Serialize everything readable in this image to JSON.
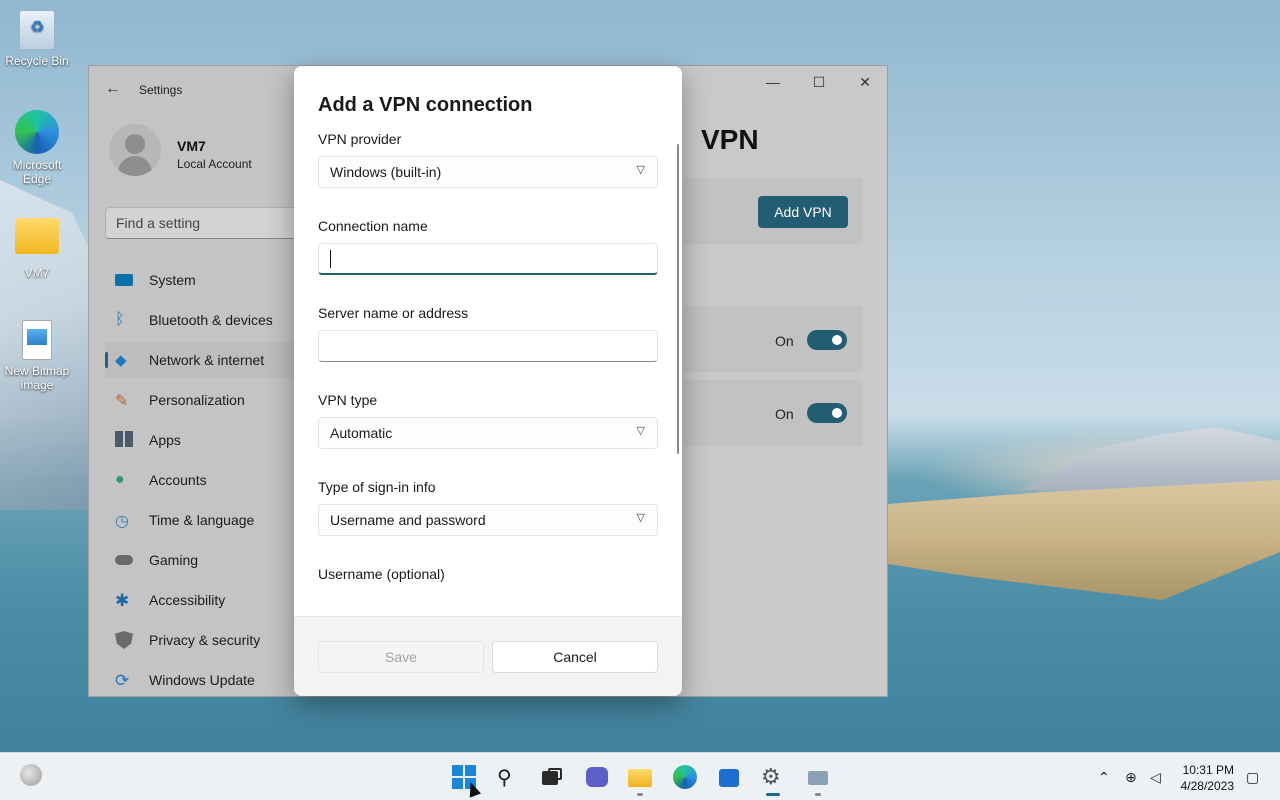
{
  "desktop": {
    "icons": [
      {
        "label": "Recycle Bin"
      },
      {
        "label": "Microsoft Edge"
      },
      {
        "label": "VM7"
      },
      {
        "label": "New Bitmap image"
      }
    ]
  },
  "settings": {
    "title": "Settings",
    "user": {
      "name": "VM7",
      "account_type": "Local Account"
    },
    "search_placeholder": "Find a setting",
    "nav": [
      {
        "label": "System",
        "icon": "system-icon",
        "color": "#0e6fb0"
      },
      {
        "label": "Bluetooth & devices",
        "icon": "bluetooth-icon",
        "color": "#1a78c2"
      },
      {
        "label": "Network & internet",
        "icon": "network-icon",
        "color": "#1a78c2",
        "active": true
      },
      {
        "label": "Personalization",
        "icon": "brush-icon",
        "color": "#b8622a"
      },
      {
        "label": "Apps",
        "icon": "apps-icon",
        "color": "#4a5a6a"
      },
      {
        "label": "Accounts",
        "icon": "accounts-icon",
        "color": "#2f9a6a"
      },
      {
        "label": "Time & language",
        "icon": "time-language-icon",
        "color": "#2f7fb5"
      },
      {
        "label": "Gaming",
        "icon": "gaming-icon",
        "color": "#6a6a6a"
      },
      {
        "label": "Accessibility",
        "icon": "accessibility-icon",
        "color": "#1b6aa8"
      },
      {
        "label": "Privacy & security",
        "icon": "shield-icon",
        "color": "#6b6b6b"
      },
      {
        "label": "Windows Update",
        "icon": "update-icon",
        "color": "#1a78c2"
      }
    ],
    "page_title": "VPN",
    "add_vpn_label": "Add VPN",
    "toggles": [
      {
        "label": "On",
        "state": true
      },
      {
        "label": "On",
        "state": true
      }
    ],
    "accent": "#235d73"
  },
  "dialog": {
    "title": "Add a VPN connection",
    "vpn_provider": {
      "label": "VPN provider",
      "value": "Windows (built-in)"
    },
    "connection_name": {
      "label": "Connection name",
      "value": ""
    },
    "server": {
      "label": "Server name or address",
      "value": ""
    },
    "vpn_type": {
      "label": "VPN type",
      "value": "Automatic"
    },
    "signin_type": {
      "label": "Type of sign-in info",
      "value": "Username and password"
    },
    "username": {
      "label": "Username (optional)"
    },
    "save_label": "Save",
    "cancel_label": "Cancel"
  },
  "taskbar": {
    "apps": [
      "start-icon",
      "search-icon",
      "task-view-icon",
      "chat-icon",
      "file-explorer-icon",
      "edge-icon",
      "store-icon",
      "settings-icon",
      "remote-desktop-icon"
    ],
    "time": "10:31 PM",
    "date": "4/28/2023"
  }
}
